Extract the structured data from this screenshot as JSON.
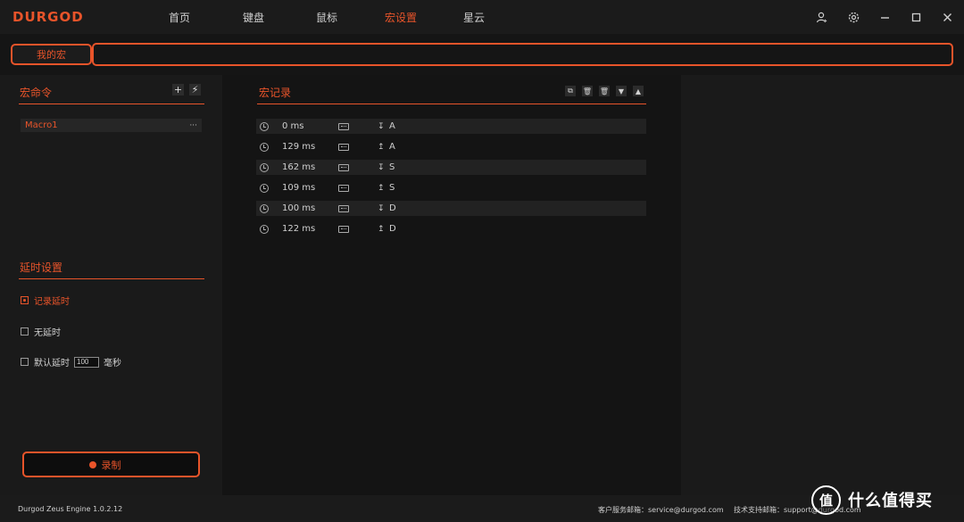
{
  "app": {
    "logo": "DURGOD"
  },
  "nav": [
    {
      "label": "首页"
    },
    {
      "label": "键盘"
    },
    {
      "label": "鼠标"
    },
    {
      "label": "宏设置",
      "active": true
    },
    {
      "label": "星云"
    }
  ],
  "window_controls": {
    "user": "👤",
    "settings": "⚙",
    "minimize": "—",
    "maximize": "☐",
    "close": "✕"
  },
  "macro_bar": {
    "my_macro_label": "我的宏",
    "name_value": ""
  },
  "left": {
    "commands_title": "宏命令",
    "add_btn": "+",
    "flash_btn": "⚡",
    "macros": [
      {
        "name": "Macro1",
        "more": "···"
      }
    ],
    "delay_title": "延时设置",
    "options": {
      "record_delay": "记录延时",
      "no_delay": "无延时",
      "default_delay": "默认延时",
      "default_value": "100",
      "unit": "毫秒"
    },
    "record_label": "录制"
  },
  "center": {
    "title": "宏记录",
    "tools": [
      "⧉",
      "🗑",
      "🗑",
      "▼",
      "▲"
    ],
    "records": [
      {
        "delay": "0 ms",
        "arrow": "↧",
        "key": "A"
      },
      {
        "delay": "129 ms",
        "arrow": "↥",
        "key": "A"
      },
      {
        "delay": "162 ms",
        "arrow": "↧",
        "key": "S"
      },
      {
        "delay": "109 ms",
        "arrow": "↥",
        "key": "S"
      },
      {
        "delay": "100 ms",
        "arrow": "↧",
        "key": "D"
      },
      {
        "delay": "122 ms",
        "arrow": "↥",
        "key": "D"
      }
    ]
  },
  "footer": {
    "version": "Durgod Zeus Engine 1.0.2.12",
    "service": "客户服务邮箱：service@durgod.com",
    "support": "技术支持邮箱：support@durgod.com"
  },
  "watermark": {
    "icon": "值",
    "text": "什么值得买"
  }
}
